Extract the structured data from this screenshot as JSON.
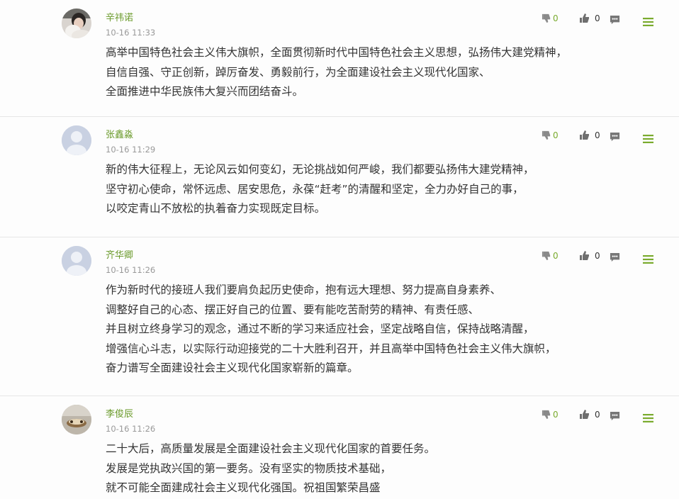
{
  "comments": [
    {
      "username": "辛祎诺",
      "time": "10-16 11:33",
      "avatar": "photo-avatar-person",
      "lines": [
        "高举中国特色社会主义伟大旗帜，全面贯彻新时代中国特色社会主义思想，弘扬伟大建党精神，",
        "自信自强、守正创新，踔厉奋发、勇毅前行，为全面建设社会主义现代化国家、",
        "全面推进中华民族伟大复兴而团结奋斗。"
      ],
      "dislike_count": "0",
      "like_count": "0"
    },
    {
      "username": "张鑫淼",
      "time": "10-16 11:29",
      "avatar": "default-user-avatar",
      "lines": [
        "新的伟大征程上，无论风云如何变幻，无论挑战如何严峻，我们都要弘扬伟大建党精神，",
        "坚守初心使命，常怀远虑、居安思危，永葆“赶考”的清醒和坚定，全力办好自己的事，",
        "以咬定青山不放松的执着奋力实现既定目标。"
      ],
      "dislike_count": "0",
      "like_count": "0"
    },
    {
      "username": "齐华卿",
      "time": "10-16 11:26",
      "avatar": "default-user-avatar",
      "lines": [
        "作为新时代的接班人我们要肩负起历史使命，抱有远大理想、努力提高自身素养、",
        "调整好自己的心态、摆正好自己的位置、要有能吃苦耐劳的精神、有责任感、",
        "并且树立终身学习的观念，通过不断的学习来适应社会，坚定战略自信，保持战略清醒，",
        "增强信心斗志，以实际行动迎接党的二十大胜利召开，并且高举中国特色社会主义伟大旗帜，",
        "奋力谱写全面建设社会主义现代化国家崭新的篇章。"
      ],
      "dislike_count": "0",
      "like_count": "0"
    },
    {
      "username": "李俊辰",
      "time": "10-16 11:26",
      "avatar": "photo-avatar-object",
      "lines": [
        "二十大后，高质量发展是全面建设社会主义现代化国家的首要任务。",
        "发展是党执政兴国的第一要务。没有坚实的物质技术基础，",
        "就不可能全面建成社会主义现代化强国。祝祖国繁荣昌盛"
      ],
      "dislike_count": "0",
      "like_count": "0"
    }
  ],
  "icons": {
    "dislike": "thumbs-down-icon",
    "like": "thumbs-up-icon",
    "reply": "comment-bubble-icon",
    "menu": "menu-lines-icon"
  },
  "colors": {
    "username": "#6a9a2a",
    "menu_icon": "#7aab2e",
    "icon_gray": "#888888"
  }
}
